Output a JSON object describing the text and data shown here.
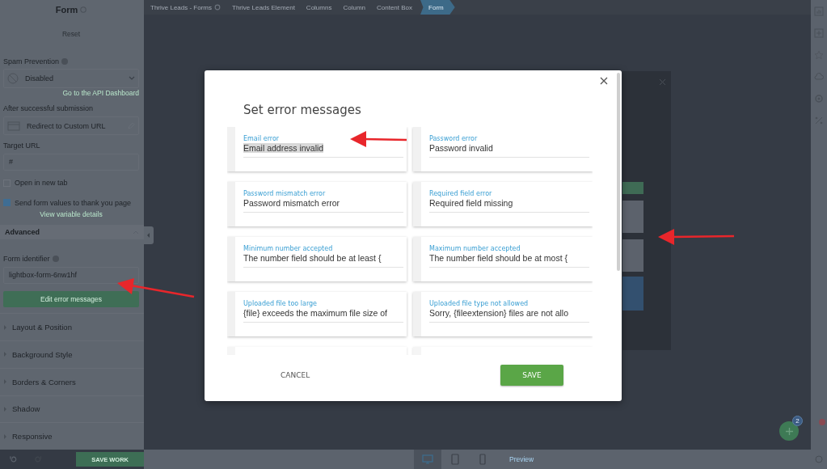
{
  "sidebar": {
    "title": "Form",
    "reset": "Reset",
    "items": [
      {
        "kind": "label",
        "text": "Spam Prevention",
        "info": true
      },
      {
        "kind": "select",
        "text": "Disabled"
      },
      {
        "kind": "link",
        "text": "Go to the API Dashboard"
      },
      {
        "kind": "label",
        "text": "After successful submission",
        "info": false
      },
      {
        "kind": "action",
        "text": "Redirect to Custom URL"
      },
      {
        "kind": "label",
        "text": "Target URL",
        "info": false
      },
      {
        "kind": "input",
        "text": "#"
      },
      {
        "kind": "checkbox",
        "text": "Open in new tab",
        "checked": false
      },
      {
        "kind": "checkbox",
        "text": "Send form values to thank you page",
        "checked": true
      },
      {
        "kind": "center-link",
        "text": "View variable details"
      },
      {
        "kind": "group",
        "text": "Advanced",
        "expanded": true
      },
      {
        "kind": "label",
        "text": "Form identifier",
        "info": true
      },
      {
        "kind": "input",
        "text": "lightbox-form-6nw1hf"
      },
      {
        "kind": "button",
        "text": "Edit error messages"
      },
      {
        "kind": "section",
        "text": "Layout & Position",
        "expanded": false
      },
      {
        "kind": "section",
        "text": "Background Style",
        "expanded": false
      },
      {
        "kind": "section",
        "text": "Borders & Corners",
        "expanded": false
      },
      {
        "kind": "section",
        "text": "Shadow",
        "expanded": false
      },
      {
        "kind": "section",
        "text": "Responsive",
        "expanded": false
      }
    ],
    "save_button": "SAVE WORK"
  },
  "breadcrumbs": [
    {
      "label": "Thrive Leads - Forms",
      "selected": false
    },
    {
      "label": "Thrive Leads Element",
      "selected": false
    },
    {
      "label": "Columns",
      "selected": false
    },
    {
      "label": "Column",
      "selected": false
    },
    {
      "label": "Content Box",
      "selected": false
    },
    {
      "label": "Form",
      "selected": true
    }
  ],
  "modal": {
    "title": "Set error messages",
    "fields": [
      {
        "label": "Email error",
        "value": "Email address invalid",
        "highlighted": true
      },
      {
        "label": "Password error",
        "value": "Password invalid",
        "highlighted": false
      },
      {
        "label": "Password mismatch error",
        "value": "Password mismatch error",
        "highlighted": false
      },
      {
        "label": "Required field error",
        "value": "Required field missing",
        "highlighted": false
      },
      {
        "label": "Minimum number accepted",
        "value": "The number field should be at least {",
        "highlighted": false
      },
      {
        "label": "Maximum number accepted",
        "value": "The number field should be at most {",
        "highlighted": false
      },
      {
        "label": "Uploaded file too large",
        "value": "{file} exceeds the maximum file size of",
        "highlighted": false
      },
      {
        "label": "Uploaded file type not allowed",
        "value": "Sorry, {fileextension} files are not allo",
        "highlighted": false
      }
    ],
    "cancel": "CANCEL",
    "save": "SAVE"
  },
  "bottom_bar": {
    "devices": [
      {
        "kind": "desktop",
        "selected": true
      },
      {
        "kind": "tablet",
        "selected": false
      },
      {
        "kind": "mobile",
        "selected": false
      }
    ],
    "preview": "Preview"
  },
  "fab_badge": "2"
}
